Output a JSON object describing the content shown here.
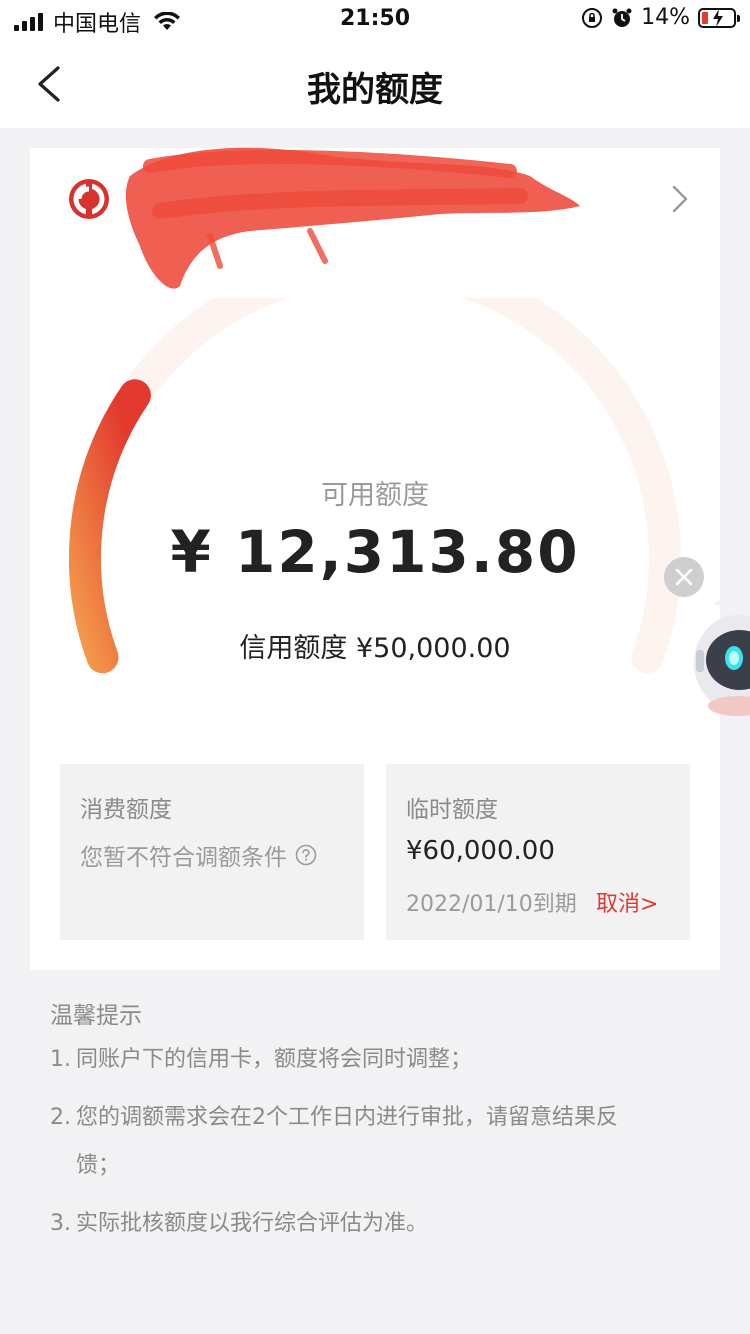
{
  "status_bar": {
    "carrier": "中国电信",
    "time": "21:50",
    "battery": "14%",
    "icons": [
      "signal-icon",
      "wifi-icon",
      "rotation-lock-icon",
      "alarm-icon",
      "battery-charging-icon"
    ]
  },
  "nav": {
    "title": "我的额度",
    "back_icon": "chevron-left-icon"
  },
  "card": {
    "bank_logo_icon": "bank-logo-icon",
    "chevron_icon": "chevron-right-icon"
  },
  "gauge": {
    "label": "可用额度",
    "amount": "¥ 12,313.80",
    "credit_line": "信用额度 ¥50,000.00",
    "available_fraction": 0.246,
    "colors": {
      "track": "#fdf3ef",
      "start": "#f39a4c",
      "end": "#e23a2e"
    }
  },
  "panels": {
    "consumption": {
      "title": "消费额度",
      "note": "您暂不符合调额条件"
    },
    "temporary": {
      "title": "临时额度",
      "amount": "¥60,000.00",
      "expiry": "2022/01/10到期",
      "cancel": "取消>"
    }
  },
  "tips": {
    "title": "温馨提示",
    "items": [
      {
        "num": "1.",
        "text": "同账户下的信用卡，额度将会同时调整；"
      },
      {
        "num": "2.",
        "text": "您的调额需求会在2个工作日内进行审批，请留意结果反",
        "cont": "馈；"
      },
      {
        "num": "3.",
        "text": "实际批核额度以我行综合评估为准。"
      }
    ]
  },
  "colors": {
    "accent": "#e23a33",
    "background": "#f2f2f4",
    "card": "#ffffff"
  }
}
